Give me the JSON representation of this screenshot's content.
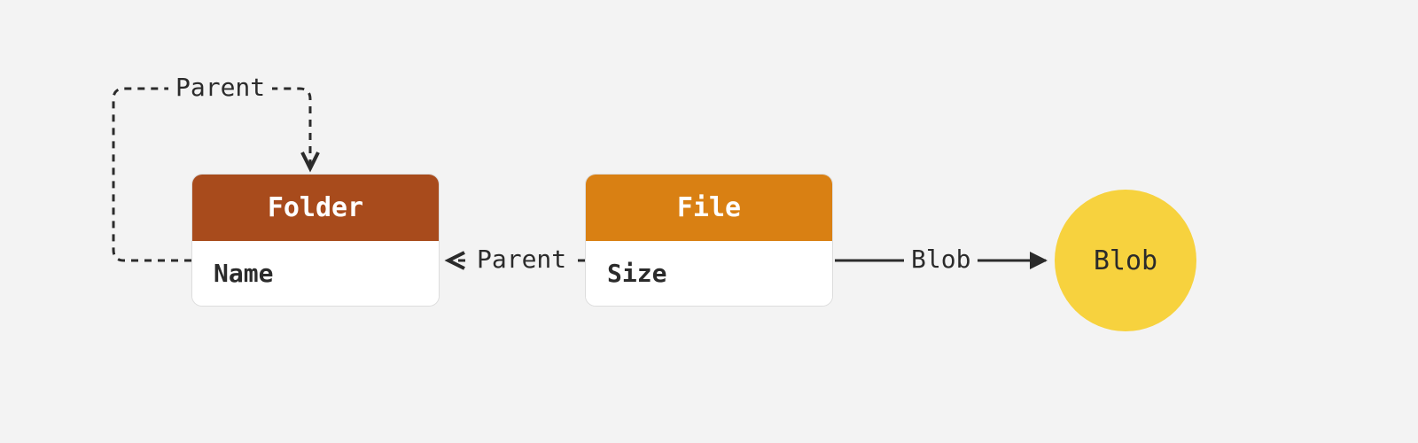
{
  "entities": {
    "folder": {
      "title": "Folder",
      "field": "Name"
    },
    "file": {
      "title": "File",
      "field": "Size"
    },
    "blob": {
      "label": "Blob"
    }
  },
  "edges": {
    "folder_self": "Parent",
    "file_to_folder": "Parent",
    "file_to_blob": "Blob"
  },
  "colors": {
    "folder_header": "#a84b1c",
    "file_header": "#d98013",
    "blob_fill": "#f7d23e",
    "background": "#f3f3f3",
    "text": "#2b2b2b"
  }
}
